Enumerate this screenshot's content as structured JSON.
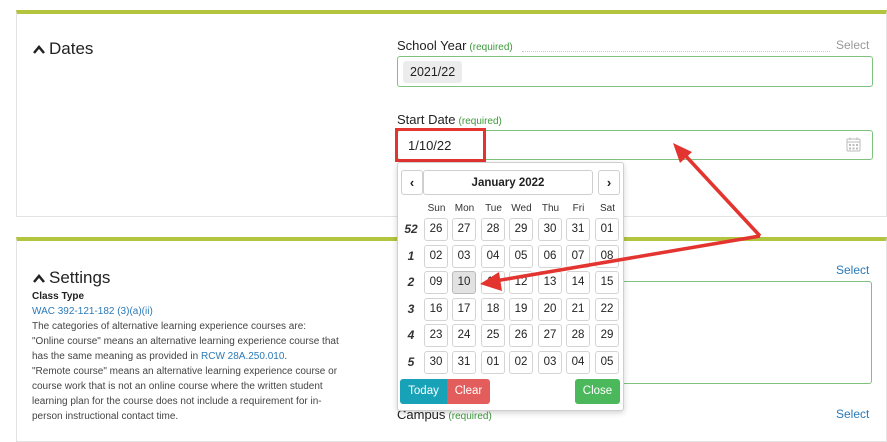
{
  "dates": {
    "section_title": "Dates",
    "school_year": {
      "label": "School Year",
      "required": "(required)",
      "select": "Select",
      "value": "2021/22"
    },
    "start_date": {
      "label": "Start Date",
      "required": "(required)",
      "value": "1/10/22"
    }
  },
  "settings": {
    "section_title": "Settings",
    "class_type_label": "Class Type",
    "wac_link": "WAC 392-121-182 (3)(a)(ii)",
    "lines": [
      "The categories of alternative learning experience courses are:",
      "\"Online course\" means an alternative learning experience course that",
      "has the same meaning as provided in",
      "\"Remote course\" means an alternative learning experience course or",
      "course work that is not an online course where the written student",
      "learning plan for the course does not include a requirement for in-",
      "person instructional contact time."
    ],
    "rcw_link": "RCW 28A.250.010",
    "rcw_suffix": ".",
    "right_select": "Select",
    "campus": {
      "label": "Campus",
      "required": "(required)",
      "select": "Select"
    }
  },
  "datepicker": {
    "month_label": "January 2022",
    "prev": "‹",
    "next": "›",
    "weekdays": [
      "Sun",
      "Mon",
      "Tue",
      "Wed",
      "Thu",
      "Fri",
      "Sat"
    ],
    "weeks": [
      {
        "num": "52",
        "days": [
          "26",
          "27",
          "28",
          "29",
          "30",
          "31",
          "01"
        ]
      },
      {
        "num": "1",
        "days": [
          "02",
          "03",
          "04",
          "05",
          "06",
          "07",
          "08"
        ]
      },
      {
        "num": "2",
        "days": [
          "09",
          "10",
          "11",
          "12",
          "13",
          "14",
          "15"
        ]
      },
      {
        "num": "3",
        "days": [
          "16",
          "17",
          "18",
          "19",
          "20",
          "21",
          "22"
        ]
      },
      {
        "num": "4",
        "days": [
          "23",
          "24",
          "25",
          "26",
          "27",
          "28",
          "29"
        ]
      },
      {
        "num": "5",
        "days": [
          "30",
          "31",
          "01",
          "02",
          "03",
          "04",
          "05"
        ]
      }
    ],
    "selected_day": "10",
    "today_label": "Today",
    "clear_label": "Clear",
    "close_label": "Close"
  },
  "colors": {
    "accent_bar": "#b3c43f",
    "required_green": "#3c9a3c",
    "link_blue": "#2a7ab8",
    "today_btn": "#17a2b8",
    "clear_btn": "#e35d5d",
    "close_btn": "#4cb85c",
    "annotation_red": "#e3342f"
  }
}
